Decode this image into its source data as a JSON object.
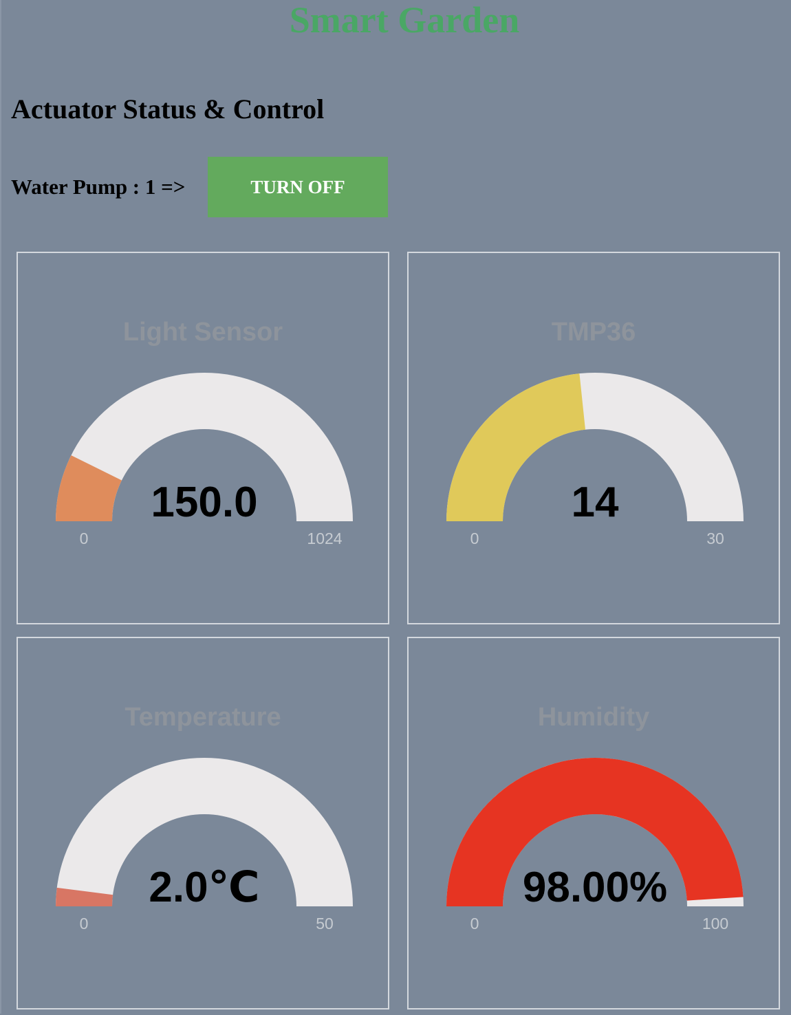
{
  "app": {
    "title": "Smart Garden"
  },
  "actuator": {
    "heading": "Actuator Status & Control",
    "pump_label": "Water Pump : 1 =>",
    "pump_button_label": "TURN OFF"
  },
  "gauges": [
    {
      "title": "Light Sensor",
      "value": 150.0,
      "display": "150.0",
      "min": 0,
      "max": 1024,
      "min_label": "0",
      "max_label": "1024",
      "color": "#df8c5c"
    },
    {
      "title": "TMP36",
      "value": 14,
      "display": "14",
      "min": 0,
      "max": 30,
      "min_label": "0",
      "max_label": "30",
      "color": "#e0c95a"
    },
    {
      "title": "Temperature",
      "value": 2.0,
      "display": "2.0℃",
      "min": 0,
      "max": 50,
      "min_label": "0",
      "max_label": "50",
      "color": "#d87664"
    },
    {
      "title": "Humidity",
      "value": 98.0,
      "display": "98.00%",
      "min": 0,
      "max": 100,
      "min_label": "0",
      "max_label": "100",
      "color": "#e63422"
    }
  ],
  "colors": {
    "background": "#7b8899",
    "title": "#4aa765",
    "button": "#63aa5d",
    "gauge_track": "#ebe9ea"
  }
}
